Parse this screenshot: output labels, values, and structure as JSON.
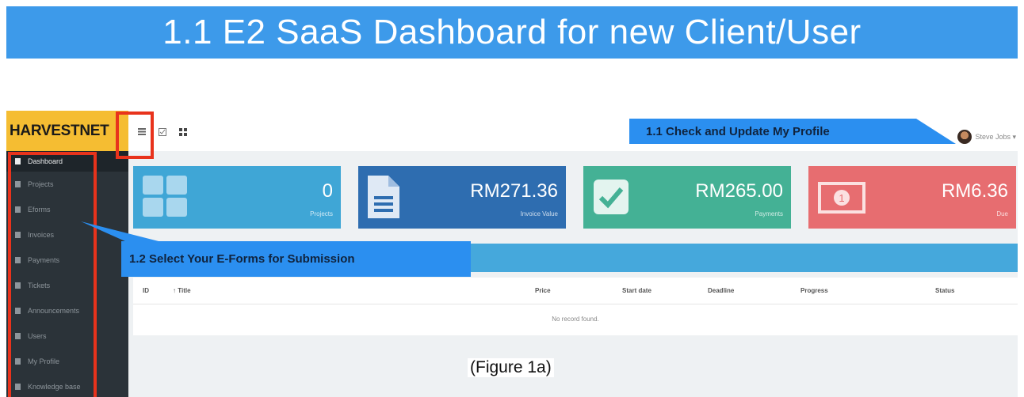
{
  "banner": {
    "title": "1.1 E2 SaaS Dashboard for new Client/User"
  },
  "app": {
    "logo": "HARVESTNET",
    "user_name": "Steve Jobs ▾"
  },
  "sidebar": {
    "items": [
      {
        "label": "Dashboard",
        "icon": "monitor-icon",
        "active": true
      },
      {
        "label": "Projects",
        "icon": "list-icon"
      },
      {
        "label": "Eforms",
        "icon": "file-icon"
      },
      {
        "label": "Invoices",
        "icon": "file-icon"
      },
      {
        "label": "Payments",
        "icon": "money-icon"
      },
      {
        "label": "Tickets",
        "icon": "gear-icon"
      },
      {
        "label": "Announcements",
        "icon": "megaphone-icon"
      },
      {
        "label": "Users",
        "icon": "user-icon"
      },
      {
        "label": "My Profile",
        "icon": "tag-icon"
      },
      {
        "label": "Knowledge base",
        "icon": "book-icon"
      }
    ]
  },
  "tiles": [
    {
      "value": "0",
      "label": "Projects",
      "color": "#3fa6d6",
      "icon": "grid-icon"
    },
    {
      "value": "RM271.36",
      "label": "Invoice Value",
      "color": "#2e6db0",
      "icon": "document-icon"
    },
    {
      "value": "RM265.00",
      "label": "Payments",
      "color": "#44b195",
      "icon": "check-icon"
    },
    {
      "value": "RM6.36",
      "label": "Due",
      "color": "#e76d70",
      "icon": "banknote-icon"
    }
  ],
  "table": {
    "headers": [
      "ID",
      "↑ Title",
      "Price",
      "Start date",
      "Deadline",
      "Progress",
      "Status"
    ],
    "empty_text": "No record found."
  },
  "callouts": {
    "profile": "1.1 Check and Update My Profile",
    "eforms": "1.2 Select Your E-Forms for Submission"
  },
  "caption": "(Figure 1a)",
  "colors": {
    "banner": "#3d9aea",
    "callout": "#2b8ff0",
    "highlight": "#e8331c",
    "logo_bg": "#f5bd32",
    "sidebar_bg": "#2b3339"
  }
}
